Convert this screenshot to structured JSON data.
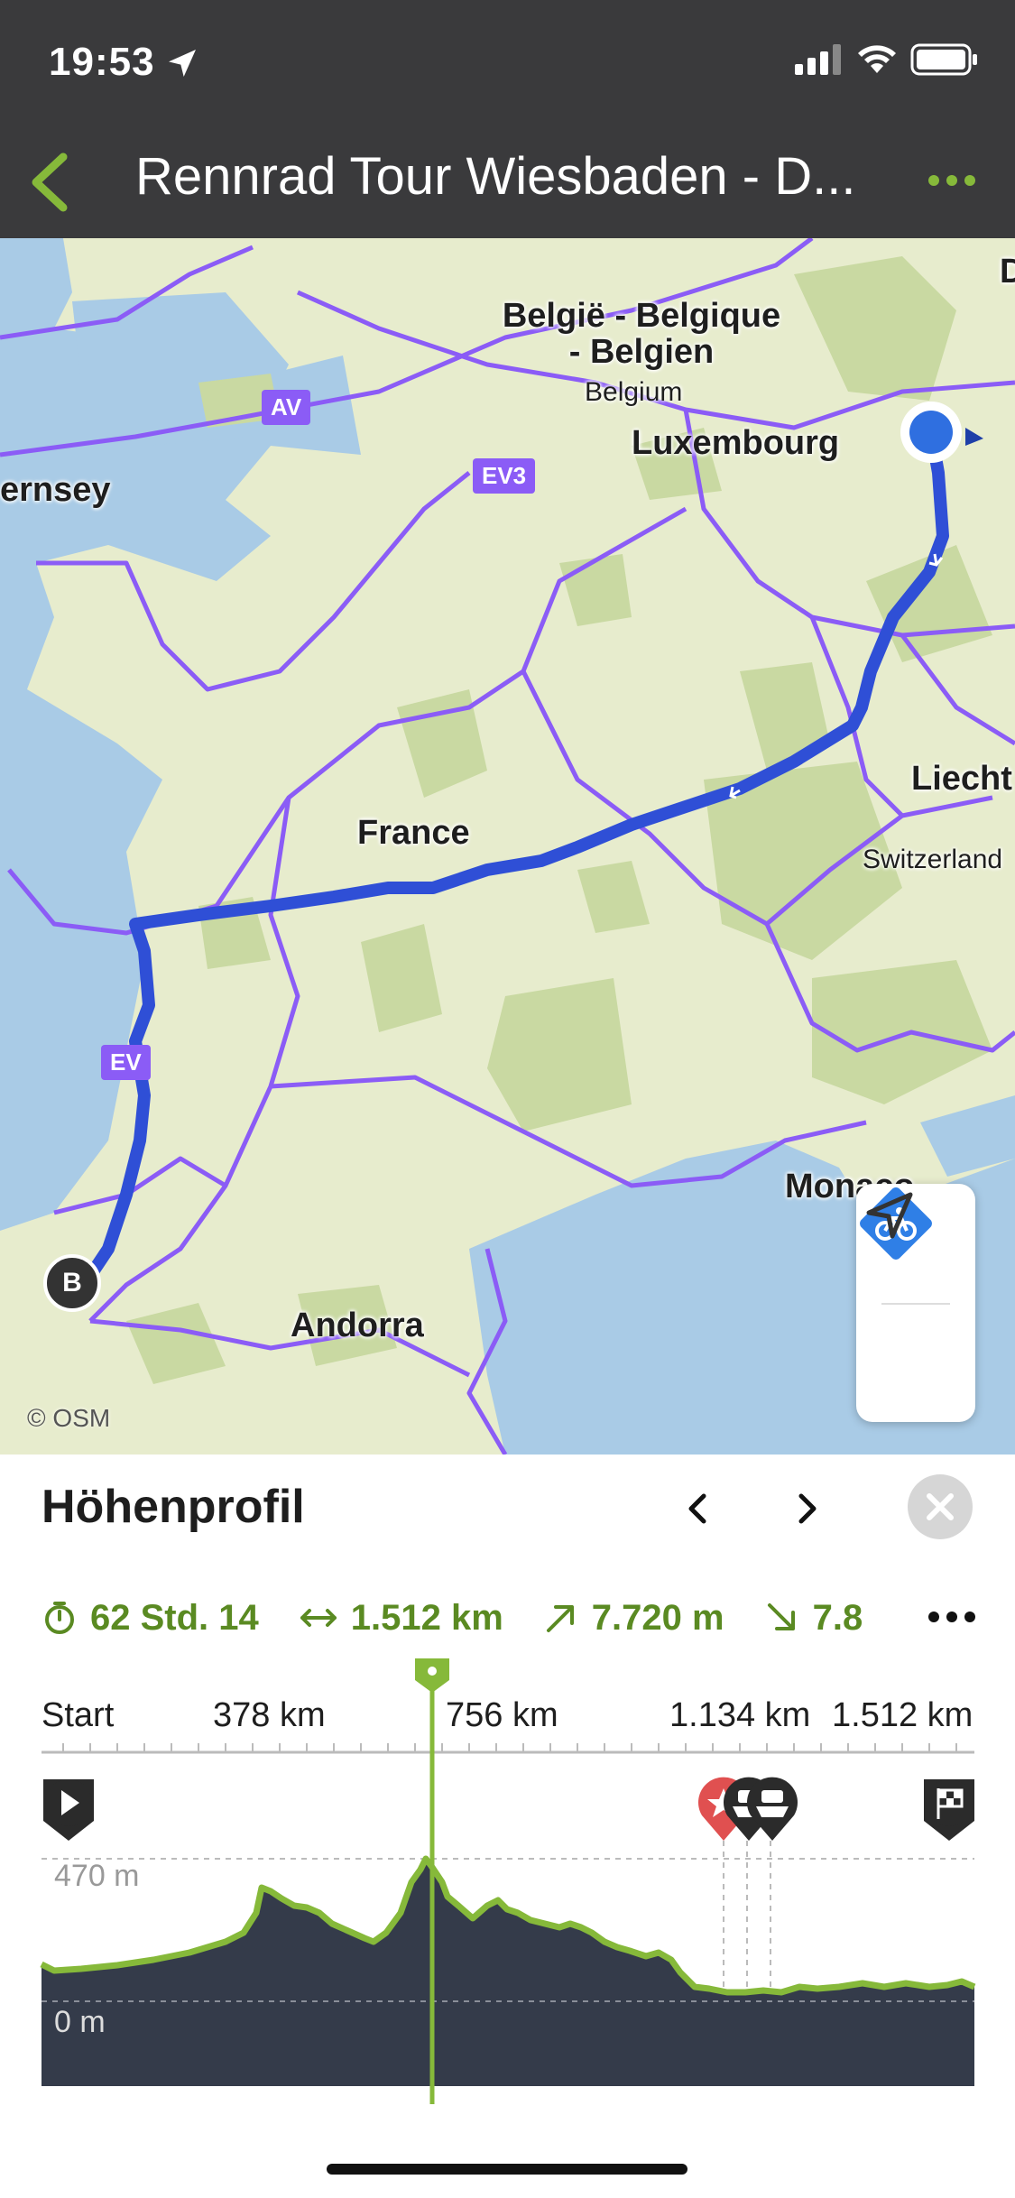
{
  "status_bar": {
    "time": "19:53"
  },
  "nav": {
    "title": "Rennrad Tour Wiesbaden - D..."
  },
  "map": {
    "labels": {
      "belgium": "België - Belgique - Belgien",
      "belgium_en": "Belgium",
      "luxembourg": "Luxembourg",
      "guernsey": "ernsey",
      "france": "France",
      "liecht": "Liecht",
      "switzerland": "Switzerland",
      "monaco": "Monaco",
      "andorra": "Andorra",
      "d": "D"
    },
    "route_badges": {
      "av": "AV",
      "ev3": "EV3",
      "ev": "EV"
    },
    "end_marker": "B",
    "attribution": "© OSM",
    "colors": {
      "route": "#2f4fd6",
      "borders": "#8b5cf6",
      "water": "#a9cbe6",
      "land": "#e7eccd",
      "forest": "#c9d9a2"
    }
  },
  "panel": {
    "title": "Höhenprofil",
    "stats": {
      "duration": "62 Std. 14",
      "distance": "1.512 km",
      "ascent": "7.720 m",
      "descent": "7.8"
    },
    "axis": {
      "start": "Start",
      "t1": "378 km",
      "t2": "756 km",
      "t3": "1.134 km",
      "t4": "1.512 km"
    },
    "elevation": {
      "max_label": "470 m",
      "min_label": "0 m"
    },
    "accent": "#86b93a"
  }
}
